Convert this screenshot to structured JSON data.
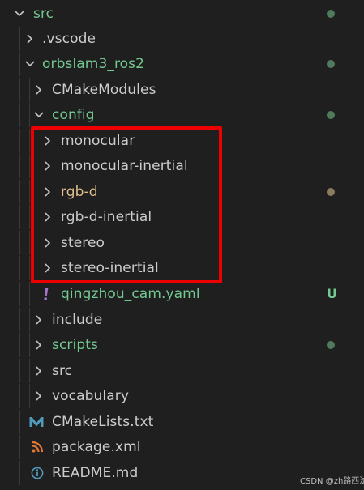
{
  "colors": {
    "background": "#1f1f1f",
    "text_default": "#cccccc",
    "text_git_untracked": "#73c991",
    "text_modified": "#e2c08d",
    "dot_green": "#4f7a5c",
    "dot_modified": "#8a7b5e",
    "chevron": "#c5c5c5",
    "guide": "#3a3a3a",
    "highlight_box": "#ee0000"
  },
  "tree": {
    "items": [
      {
        "label": "src",
        "expanded": true,
        "color": "green",
        "decoration": "dot-green"
      },
      {
        "label": ".vscode",
        "expanded": false,
        "color": "default",
        "decoration": ""
      },
      {
        "label": "orbslam3_ros2",
        "expanded": true,
        "color": "green",
        "decoration": "dot-green"
      },
      {
        "label": "CMakeModules",
        "expanded": false,
        "color": "default",
        "decoration": ""
      },
      {
        "label": "config",
        "expanded": true,
        "color": "green",
        "decoration": "dot-green"
      },
      {
        "label": "monocular",
        "expanded": false,
        "color": "default",
        "decoration": ""
      },
      {
        "label": "monocular-inertial",
        "expanded": false,
        "color": "default",
        "decoration": ""
      },
      {
        "label": "rgb-d",
        "expanded": false,
        "color": "modified",
        "decoration": "dot-modified"
      },
      {
        "label": "rgb-d-inertial",
        "expanded": false,
        "color": "default",
        "decoration": ""
      },
      {
        "label": "stereo",
        "expanded": false,
        "color": "default",
        "decoration": ""
      },
      {
        "label": "stereo-inertial",
        "expanded": false,
        "color": "default",
        "decoration": ""
      },
      {
        "label": "qingzhou_cam.yaml",
        "icon": "yaml-exclamation-icon",
        "color": "green",
        "decoration": "U"
      },
      {
        "label": "include",
        "expanded": false,
        "color": "default",
        "decoration": ""
      },
      {
        "label": "scripts",
        "expanded": false,
        "color": "green",
        "decoration": "dot-green"
      },
      {
        "label": "src",
        "expanded": false,
        "color": "default",
        "decoration": ""
      },
      {
        "label": "vocabulary",
        "expanded": false,
        "color": "default",
        "decoration": ""
      },
      {
        "label": "CMakeLists.txt",
        "icon": "cmake-m-icon",
        "color": "default",
        "decoration": ""
      },
      {
        "label": "package.xml",
        "icon": "rss-icon",
        "color": "default",
        "decoration": ""
      },
      {
        "label": "README.md",
        "icon": "info-icon",
        "color": "default",
        "decoration": ""
      }
    ]
  },
  "watermark": "CSDN @zh路西法"
}
